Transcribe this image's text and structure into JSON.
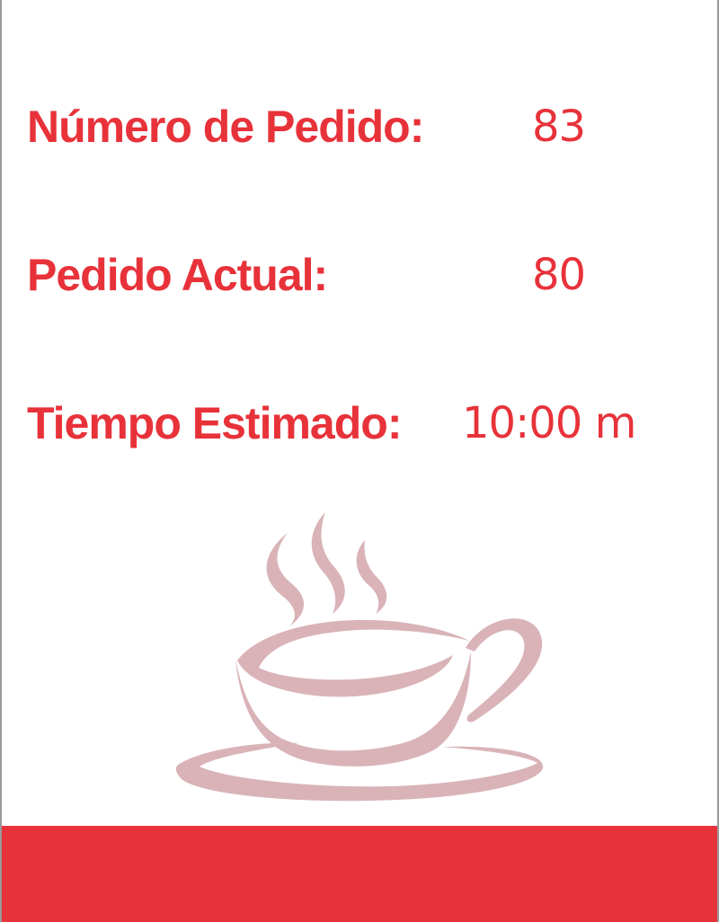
{
  "colors": {
    "accent": "#e8323a",
    "cup": "#d9b3b7",
    "background": "#ffffff"
  },
  "order_info": {
    "order_number_label": "Número de Pedido:",
    "order_number_value": "83",
    "current_order_label": "Pedido Actual:",
    "current_order_value": "80",
    "estimated_time_label": "Tiempo Estimado:",
    "estimated_time_value": "10:00 m"
  },
  "illustration": {
    "icon": "coffee-cup-icon"
  }
}
